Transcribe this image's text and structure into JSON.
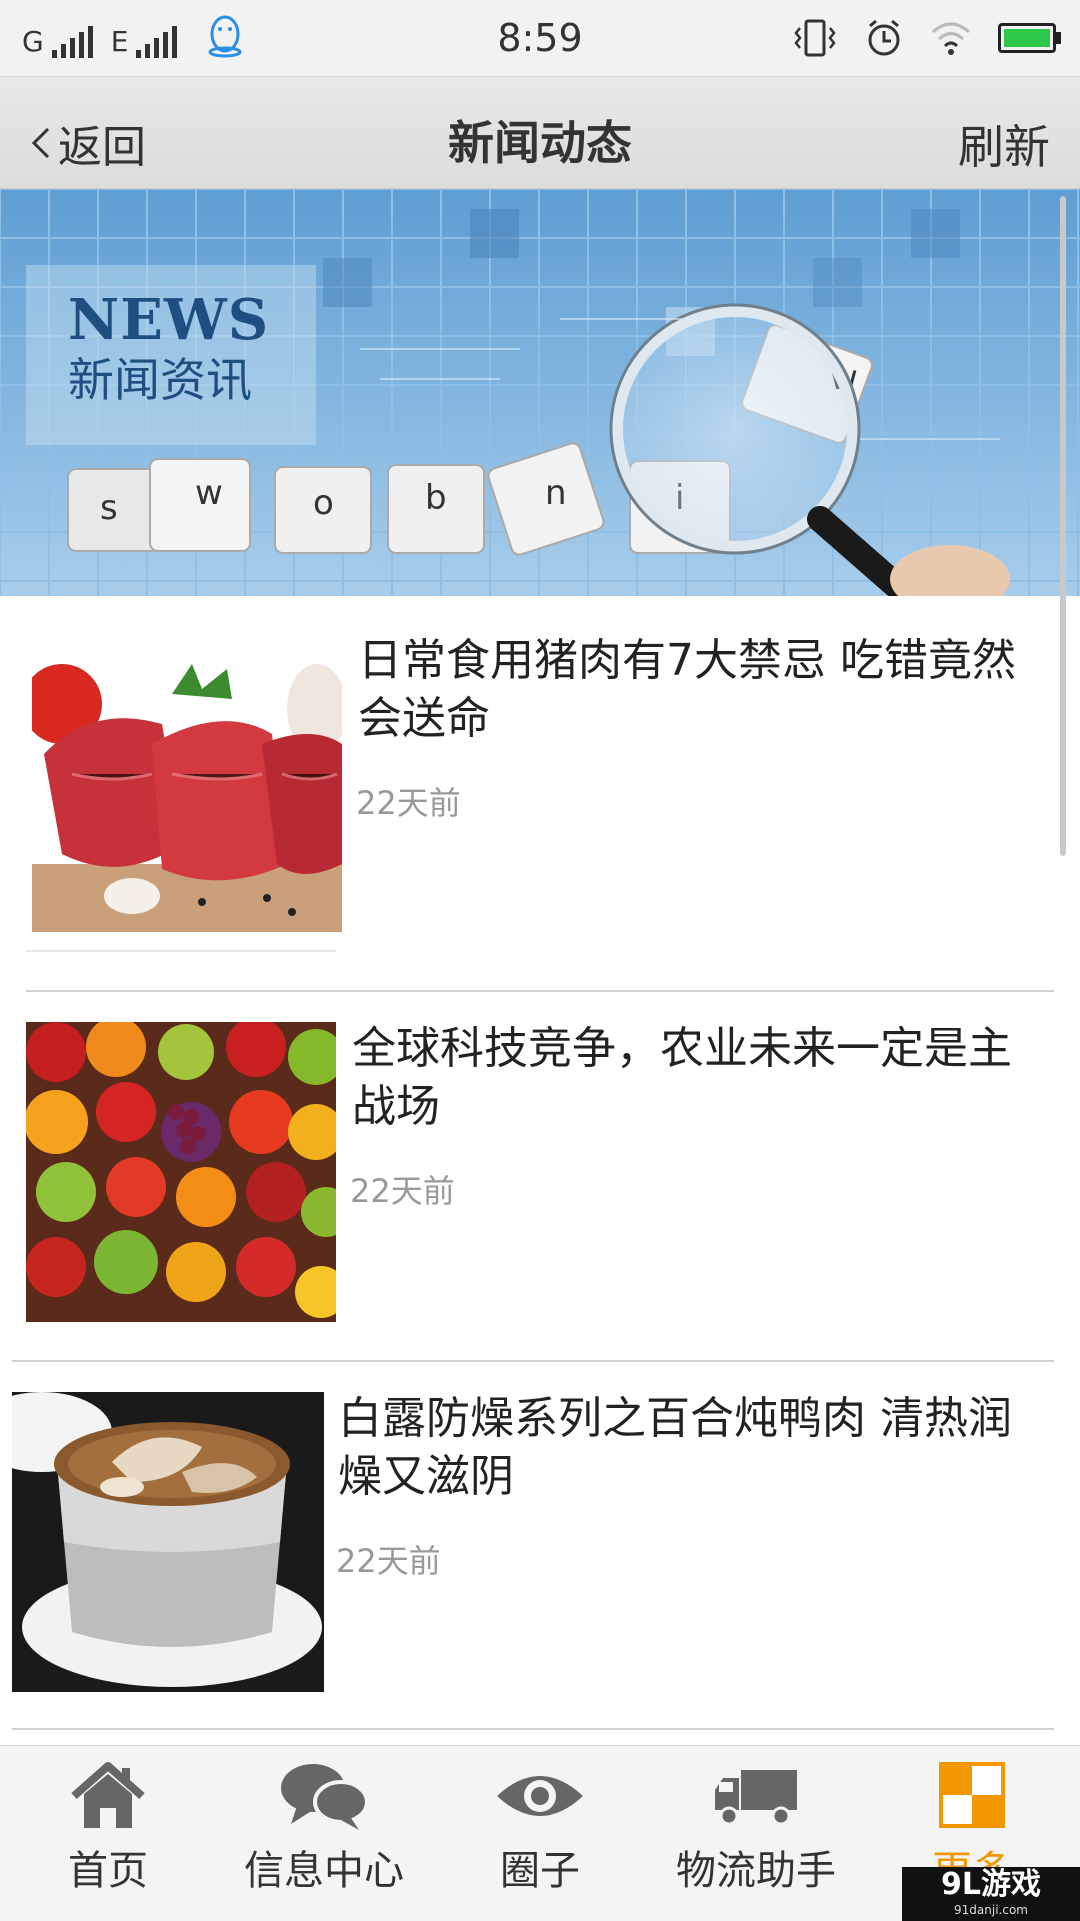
{
  "status_bar": {
    "network_1": "G",
    "network_2": "E",
    "time": "8:59"
  },
  "nav": {
    "back_label": "返回",
    "title": "新闻动态",
    "refresh_label": "刷新"
  },
  "banner": {
    "heading_en": "NEWS",
    "heading_cn": "新闻资讯"
  },
  "news": [
    {
      "title": "日常食用猪肉有7大禁忌 吃错竟然会送命",
      "time": "22天前",
      "image": "raw-meat-photo"
    },
    {
      "title": "全球科技竞争，农业未来一定是主战场",
      "time": "22天前",
      "image": "fruit-pile-photo"
    },
    {
      "title": "白露防燥系列之百合炖鸭肉 清热润燥又滋阴",
      "time": "22天前",
      "image": "duck-soup-photo"
    }
  ],
  "tabs": [
    {
      "label": "首页",
      "icon": "home-icon"
    },
    {
      "label": "信息中心",
      "icon": "chat-bubbles-icon"
    },
    {
      "label": "圈子",
      "icon": "eye-icon"
    },
    {
      "label": "物流助手",
      "icon": "truck-icon"
    },
    {
      "label": "更多",
      "icon": "more-grid-icon",
      "active": true
    }
  ],
  "colors": {
    "accent": "#f39700",
    "battery": "#2ec84a",
    "banner_blue": "#5b9bd0"
  },
  "watermark": {
    "brand": "9L游戏",
    "site": "91danji.com"
  }
}
